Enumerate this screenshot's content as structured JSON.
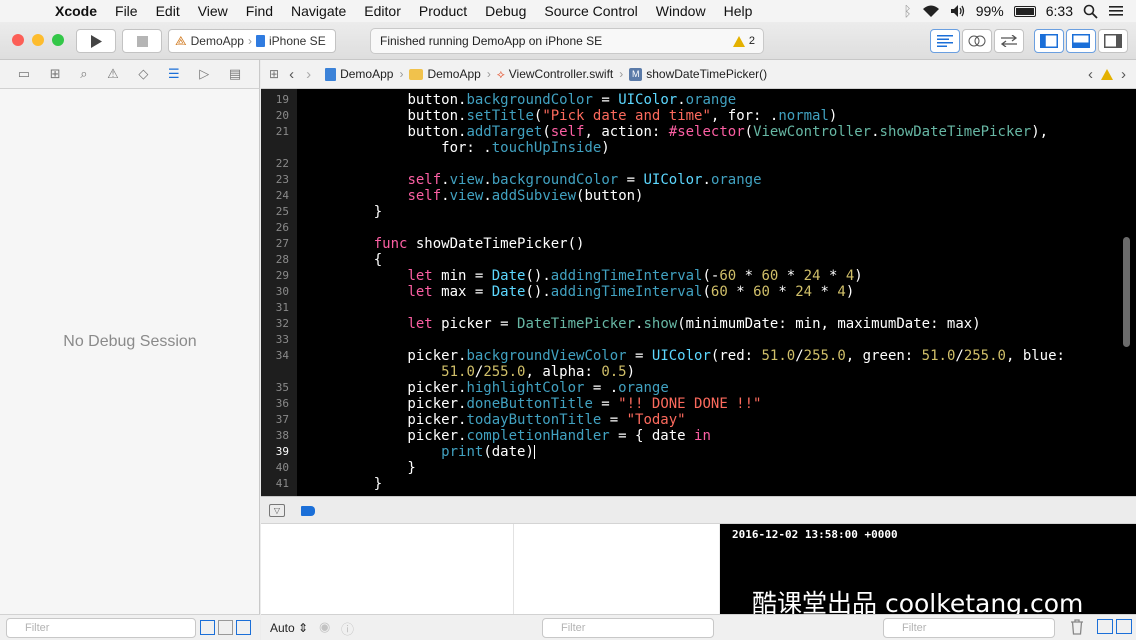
{
  "menubar": {
    "app_name": "Xcode",
    "items": [
      "File",
      "Edit",
      "View",
      "Find",
      "Navigate",
      "Editor",
      "Product",
      "Debug",
      "Source Control",
      "Window",
      "Help"
    ],
    "battery": "99%",
    "clock": "6:33"
  },
  "toolbar": {
    "scheme": "DemoApp",
    "destination": "iPhone SE",
    "activity_status": "Finished running DemoApp on iPhone SE",
    "warning_count": "2"
  },
  "jumpbar": {
    "crumbs": [
      "DemoApp",
      "DemoApp",
      "ViewController.swift",
      "showDateTimePicker()"
    ],
    "method_badge": "M"
  },
  "navigator": {
    "empty_message": "No Debug Session",
    "filter_placeholder": "Filter"
  },
  "editor": {
    "lines": [
      {
        "n": "19",
        "tokens": [
          [
            "        ",
            "pl"
          ],
          [
            "button",
            "pl"
          ],
          [
            ".",
            "pl"
          ],
          [
            "backgroundColor",
            "fn"
          ],
          [
            " = ",
            "pl"
          ],
          [
            "UIColor",
            "ty"
          ],
          [
            ".",
            "pl"
          ],
          [
            "orange",
            "fn"
          ]
        ]
      },
      {
        "n": "20",
        "tokens": [
          [
            "        ",
            "pl"
          ],
          [
            "button",
            "pl"
          ],
          [
            ".",
            "pl"
          ],
          [
            "setTitle",
            "fn"
          ],
          [
            "(",
            "pl"
          ],
          [
            "\"Pick date and time\"",
            "str"
          ],
          [
            ", for: .",
            "pl"
          ],
          [
            "normal",
            "fn"
          ],
          [
            ")",
            "pl"
          ]
        ]
      },
      {
        "n": "21",
        "tokens": [
          [
            "        ",
            "pl"
          ],
          [
            "button",
            "pl"
          ],
          [
            ".",
            "pl"
          ],
          [
            "addTarget",
            "fn"
          ],
          [
            "(",
            "pl"
          ],
          [
            "self",
            "kw"
          ],
          [
            ", action: ",
            "pl"
          ],
          [
            "#selector",
            "kw"
          ],
          [
            "(",
            "pl"
          ],
          [
            "ViewController",
            "teal"
          ],
          [
            ".",
            "pl"
          ],
          [
            "showDateTimePicker",
            "teal"
          ],
          [
            "),",
            "pl"
          ]
        ]
      },
      {
        "n": "",
        "tokens": [
          [
            "            for: .",
            "pl"
          ],
          [
            "touchUpInside",
            "fn"
          ],
          [
            ")",
            "pl"
          ]
        ]
      },
      {
        "n": "22",
        "tokens": []
      },
      {
        "n": "23",
        "tokens": [
          [
            "        ",
            "pl"
          ],
          [
            "self",
            "kw"
          ],
          [
            ".",
            "pl"
          ],
          [
            "view",
            "fn"
          ],
          [
            ".",
            "pl"
          ],
          [
            "backgroundColor",
            "fn"
          ],
          [
            " = ",
            "pl"
          ],
          [
            "UIColor",
            "ty"
          ],
          [
            ".",
            "pl"
          ],
          [
            "orange",
            "fn"
          ]
        ]
      },
      {
        "n": "24",
        "tokens": [
          [
            "        ",
            "pl"
          ],
          [
            "self",
            "kw"
          ],
          [
            ".",
            "pl"
          ],
          [
            "view",
            "fn"
          ],
          [
            ".",
            "pl"
          ],
          [
            "addSubview",
            "fn"
          ],
          [
            "(button)",
            "pl"
          ]
        ]
      },
      {
        "n": "25",
        "tokens": [
          [
            "    }",
            "pl"
          ]
        ]
      },
      {
        "n": "26",
        "tokens": []
      },
      {
        "n": "27",
        "tokens": [
          [
            "    ",
            "pl"
          ],
          [
            "func",
            "kw"
          ],
          [
            " showDateTimePicker()",
            "pl"
          ]
        ]
      },
      {
        "n": "28",
        "tokens": [
          [
            "    {",
            "pl"
          ]
        ]
      },
      {
        "n": "29",
        "tokens": [
          [
            "        ",
            "pl"
          ],
          [
            "let",
            "kw"
          ],
          [
            " min = ",
            "pl"
          ],
          [
            "Date",
            "ty"
          ],
          [
            "().",
            "pl"
          ],
          [
            "addingTimeInterval",
            "fn"
          ],
          [
            "(-",
            "pl"
          ],
          [
            "60",
            "num"
          ],
          [
            " * ",
            "pl"
          ],
          [
            "60",
            "num"
          ],
          [
            " * ",
            "pl"
          ],
          [
            "24",
            "num"
          ],
          [
            " * ",
            "pl"
          ],
          [
            "4",
            "num"
          ],
          [
            ")",
            "pl"
          ]
        ]
      },
      {
        "n": "30",
        "tokens": [
          [
            "        ",
            "pl"
          ],
          [
            "let",
            "kw"
          ],
          [
            " max = ",
            "pl"
          ],
          [
            "Date",
            "ty"
          ],
          [
            "().",
            "pl"
          ],
          [
            "addingTimeInterval",
            "fn"
          ],
          [
            "(",
            "pl"
          ],
          [
            "60",
            "num"
          ],
          [
            " * ",
            "pl"
          ],
          [
            "60",
            "num"
          ],
          [
            " * ",
            "pl"
          ],
          [
            "24",
            "num"
          ],
          [
            " * ",
            "pl"
          ],
          [
            "4",
            "num"
          ],
          [
            ")",
            "pl"
          ]
        ]
      },
      {
        "n": "31",
        "tokens": []
      },
      {
        "n": "32",
        "tokens": [
          [
            "        ",
            "pl"
          ],
          [
            "let",
            "kw"
          ],
          [
            " picker = ",
            "pl"
          ],
          [
            "DateTimePicker",
            "teal"
          ],
          [
            ".",
            "pl"
          ],
          [
            "show",
            "teal"
          ],
          [
            "(minimumDate: min, maximumDate: max)",
            "pl"
          ]
        ]
      },
      {
        "n": "33",
        "tokens": []
      },
      {
        "n": "34",
        "tokens": [
          [
            "        picker.",
            "pl"
          ],
          [
            "backgroundViewColor",
            "fn"
          ],
          [
            " = ",
            "pl"
          ],
          [
            "UIColor",
            "ty"
          ],
          [
            "(red: ",
            "pl"
          ],
          [
            "51.0",
            "num"
          ],
          [
            "/",
            "pl"
          ],
          [
            "255.0",
            "num"
          ],
          [
            ", green: ",
            "pl"
          ],
          [
            "51.0",
            "num"
          ],
          [
            "/",
            "pl"
          ],
          [
            "255.0",
            "num"
          ],
          [
            ", blue:",
            "pl"
          ]
        ]
      },
      {
        "n": "",
        "tokens": [
          [
            "            ",
            "pl"
          ],
          [
            "51.0",
            "num"
          ],
          [
            "/",
            "pl"
          ],
          [
            "255.0",
            "num"
          ],
          [
            ", alpha: ",
            "pl"
          ],
          [
            "0.5",
            "num"
          ],
          [
            ")",
            "pl"
          ]
        ]
      },
      {
        "n": "35",
        "tokens": [
          [
            "        picker.",
            "pl"
          ],
          [
            "highlightColor",
            "fn"
          ],
          [
            " = .",
            "pl"
          ],
          [
            "orange",
            "fn"
          ]
        ]
      },
      {
        "n": "36",
        "tokens": [
          [
            "        picker.",
            "pl"
          ],
          [
            "doneButtonTitle",
            "fn"
          ],
          [
            " = ",
            "pl"
          ],
          [
            "\"!! DONE DONE !!\"",
            "str"
          ]
        ]
      },
      {
        "n": "37",
        "tokens": [
          [
            "        picker.",
            "pl"
          ],
          [
            "todayButtonTitle",
            "fn"
          ],
          [
            " = ",
            "pl"
          ],
          [
            "\"Today\"",
            "str"
          ]
        ]
      },
      {
        "n": "38",
        "tokens": [
          [
            "        picker.",
            "pl"
          ],
          [
            "completionHandler",
            "fn"
          ],
          [
            " = { date ",
            "pl"
          ],
          [
            "in",
            "kw"
          ]
        ]
      },
      {
        "n": "39",
        "tokens": [
          [
            "            ",
            "pl"
          ],
          [
            "print",
            "fn"
          ],
          [
            "(date)",
            "pl"
          ]
        ],
        "current": true
      },
      {
        "n": "40",
        "tokens": [
          [
            "        }",
            "pl"
          ]
        ]
      },
      {
        "n": "41",
        "tokens": [
          [
            "    }",
            "pl"
          ]
        ]
      }
    ]
  },
  "debug": {
    "scope_label": "Auto",
    "filter_placeholder": "Filter",
    "console_output": "2016-12-02 13:58:00 +0000"
  },
  "watermark": "酷课堂出品 coolketang.com",
  "colors": {
    "close": "#fc5f57",
    "minimize": "#fdbc2e",
    "zoom": "#33c748",
    "accent": "#1b6fd8",
    "editor_bg": "#000000"
  },
  "icons": {
    "apple": "apple-logo-icon",
    "run": "play-icon",
    "stop": "stop-icon",
    "warning": "warning-triangle-icon",
    "wifi": "wifi-icon",
    "bluetooth": "bluetooth-icon",
    "volume": "volume-icon",
    "search": "search-icon"
  }
}
